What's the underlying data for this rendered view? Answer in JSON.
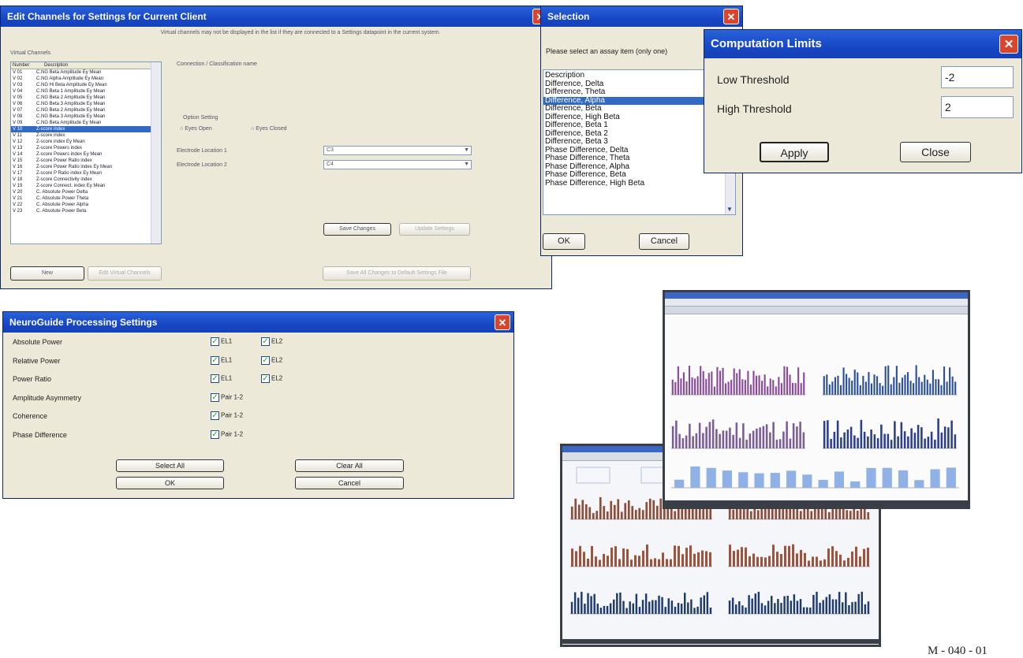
{
  "edit_window": {
    "title": "Edit Channels for Settings for Current Client",
    "notice": "Virtual channels may not be displayed in the list if they are connected to a Settings datapoint in the current system.",
    "group_label": "Virtual Channels",
    "col_number": "Number",
    "col_description": "Description",
    "rows": [
      {
        "num": "V 01",
        "desc": "C.NG Beta Amplitude Ey Mean"
      },
      {
        "num": "V 02",
        "desc": "C.NG Alpha Amplitude Ey Mean"
      },
      {
        "num": "V 03",
        "desc": "C.NG Hi Beta Amplitude Ey Mean"
      },
      {
        "num": "V 04",
        "desc": "C.NG Beta 1 Amplitude Ey Mean"
      },
      {
        "num": "V 05",
        "desc": "C.NG Beta 2 Amplitude Ey Mean"
      },
      {
        "num": "V 06",
        "desc": "C.NG Beta 3 Amplitude Ey Mean"
      },
      {
        "num": "V 07",
        "desc": "C.NG Beta 2 Amplitude Ey Mean"
      },
      {
        "num": "V 08",
        "desc": "C.NG Beta 3 Amplitude Ey Mean"
      },
      {
        "num": "V 09",
        "desc": "C.NG Beta Amplitude Ey Mean"
      },
      {
        "num": "V 10",
        "desc": "Z-score index"
      },
      {
        "num": "V 11",
        "desc": "Z-score index"
      },
      {
        "num": "V 12",
        "desc": "Z-score index Ey Mean"
      },
      {
        "num": "V 13",
        "desc": "Z-score Powers index"
      },
      {
        "num": "V 14",
        "desc": "Z-score Powers index Ey Mean"
      },
      {
        "num": "V 15",
        "desc": "Z-score Power Ratio index"
      },
      {
        "num": "V 16",
        "desc": "Z-score Power Ratio index Ey Mean"
      },
      {
        "num": "V 17",
        "desc": "Z-score P Ratio index Ey Mean"
      },
      {
        "num": "V 18",
        "desc": "Z-score Connectivity index"
      },
      {
        "num": "V 19",
        "desc": "Z-score Connect. index Ey Mean"
      },
      {
        "num": "V 20",
        "desc": "C. Absolute Power Delta"
      },
      {
        "num": "V 21",
        "desc": "C. Absolute Power Theta"
      },
      {
        "num": "V 22",
        "desc": "C. Absolute Power Alpha"
      },
      {
        "num": "V 23",
        "desc": "C. Absolute Power Beta"
      }
    ],
    "section_label": "Connection / Classification name",
    "option_label": "Option Setting",
    "radio_eyes_open": "Eyes Open",
    "radio_eyes_closed": "Eyes Closed",
    "loc1_label": "Electrode Location 1",
    "loc1_value": "C3",
    "loc2_label": "Electrode Location 2",
    "loc2_value": "C4",
    "save_label": "Save Changes",
    "update_label": "Update Settings",
    "new_label": "New",
    "edit_label": "Edit Virtual Channels",
    "export_label": "Save All Changes to Default Settings File"
  },
  "selection_window": {
    "title": "Selection",
    "prompt": "Please select an assay item (only one)",
    "col_label": "Description",
    "items": [
      "Difference, Delta",
      "Difference, Theta",
      "Difference, Alpha",
      "Difference, Beta",
      "Difference, High Beta",
      "Difference, Beta 1",
      "Difference, Beta 2",
      "Difference, Beta 3",
      "Phase Difference, Delta",
      "Phase Difference, Theta",
      "Phase Difference, Alpha",
      "Phase Difference, Beta",
      "Phase Difference, High Beta"
    ],
    "ok_label": "OK",
    "cancel_label": "Cancel"
  },
  "computation_limits": {
    "title": "Computation Limits",
    "low_label": "Low Threshold",
    "low_value": "-2",
    "high_label": "High Threshold",
    "high_value": "2",
    "apply_label": "Apply",
    "close_label": "Close"
  },
  "processing_settings": {
    "title": "NeuroGuide Processing Settings",
    "rows": [
      {
        "label": "Absolute Power",
        "c1": "EL1",
        "c2": "EL2"
      },
      {
        "label": "Relative Power",
        "c1": "EL1",
        "c2": "EL2"
      },
      {
        "label": "Power Ratio",
        "c1": "EL1",
        "c2": "EL2"
      },
      {
        "label": "Amplitude Asymmetry",
        "c1": "Pair 1-2",
        "c2": ""
      },
      {
        "label": "Coherence",
        "c1": "Pair 1-2",
        "c2": ""
      },
      {
        "label": "Phase Difference",
        "c1": "Pair 1-2",
        "c2": ""
      }
    ],
    "select_all_label": "Select All",
    "clear_all_label": "Clear All",
    "ok_label": "OK",
    "cancel_label": "Cancel"
  },
  "figure_code": "M - 040 - 01",
  "colors": {
    "titlebar": "#1747c6",
    "window_bg": "#ece9d8",
    "selection": "#316ac5",
    "close_button": "#d9442c",
    "check": "#21a121"
  }
}
